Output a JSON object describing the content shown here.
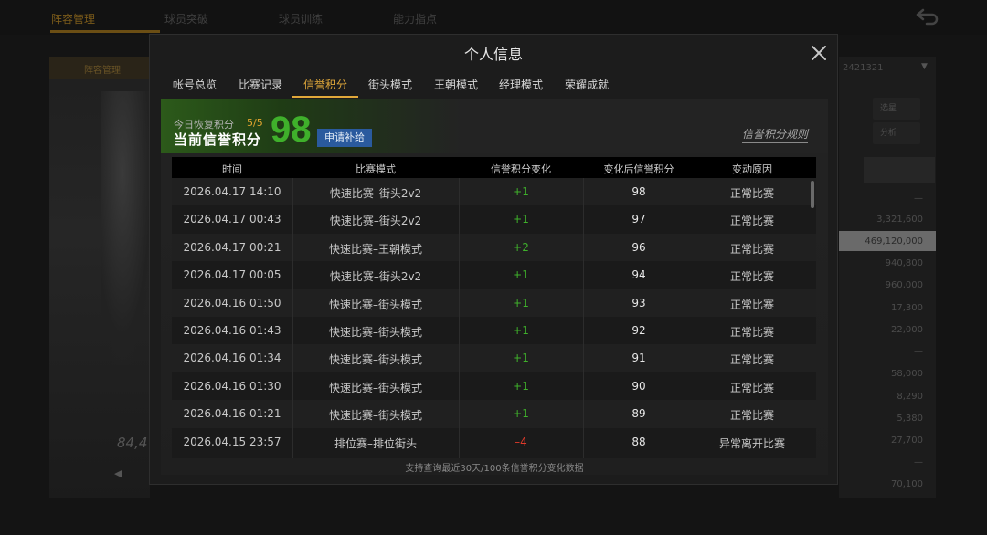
{
  "background": {
    "tabs": [
      "阵容管理",
      "球员突破",
      "球员训练",
      "能力指点"
    ],
    "left_title": "阵容管理",
    "player_score": "84,4",
    "account_id": "2421321",
    "right_buttons": [
      "选星",
      "分析"
    ],
    "right_numbers": [
      "—",
      "3,321,600",
      "469,120,000",
      "940,800",
      "960,000",
      "17,300",
      "22,000",
      "—",
      "58,000",
      "8,290",
      "5,380",
      "27,700",
      "—",
      "70,100"
    ]
  },
  "modal": {
    "title": "个人信息",
    "tabs": [
      "帐号总览",
      "比赛记录",
      "信誉积分",
      "街头模式",
      "王朝模式",
      "经理模式",
      "荣耀成就"
    ],
    "active_tab_index": 2,
    "banner": {
      "recover_label": "今日恢复积分",
      "recover_value": "5/5",
      "credit_label": "当前信誉积分",
      "credit_score": "98",
      "apply_button": "申请补给",
      "rules_link": "信誉积分规则"
    },
    "table": {
      "columns": [
        "时间",
        "比赛模式",
        "信誉积分变化",
        "变化后信誉积分",
        "变动原因"
      ],
      "rows": [
        {
          "time": "2026.04.17  14:10",
          "mode": "快速比赛–街头2v2",
          "delta": "+1",
          "after": "98",
          "reason": "正常比赛"
        },
        {
          "time": "2026.04.17  00:43",
          "mode": "快速比赛–街头2v2",
          "delta": "+1",
          "after": "97",
          "reason": "正常比赛"
        },
        {
          "time": "2026.04.17  00:21",
          "mode": "快速比赛–王朝模式",
          "delta": "+2",
          "after": "96",
          "reason": "正常比赛"
        },
        {
          "time": "2026.04.17  00:05",
          "mode": "快速比赛–街头2v2",
          "delta": "+1",
          "after": "94",
          "reason": "正常比赛"
        },
        {
          "time": "2026.04.16  01:50",
          "mode": "快速比赛–街头模式",
          "delta": "+1",
          "after": "93",
          "reason": "正常比赛"
        },
        {
          "time": "2026.04.16  01:43",
          "mode": "快速比赛–街头模式",
          "delta": "+1",
          "after": "92",
          "reason": "正常比赛"
        },
        {
          "time": "2026.04.16  01:34",
          "mode": "快速比赛–街头模式",
          "delta": "+1",
          "after": "91",
          "reason": "正常比赛"
        },
        {
          "time": "2026.04.16  01:30",
          "mode": "快速比赛–街头模式",
          "delta": "+1",
          "after": "90",
          "reason": "正常比赛"
        },
        {
          "time": "2026.04.16  01:21",
          "mode": "快速比赛–街头模式",
          "delta": "+1",
          "after": "89",
          "reason": "正常比赛"
        },
        {
          "time": "2026.04.15  23:57",
          "mode": "排位赛–排位街头",
          "delta": "–4",
          "after": "88",
          "reason": "异常离开比赛"
        }
      ]
    },
    "footer_note": "支持查询最近30天/100条信誉积分变化数据"
  },
  "colors": {
    "accent": "#e0a83a",
    "positive": "#3fb02b",
    "negative": "#e03a2a",
    "apply_button": "#2a5a9e"
  }
}
